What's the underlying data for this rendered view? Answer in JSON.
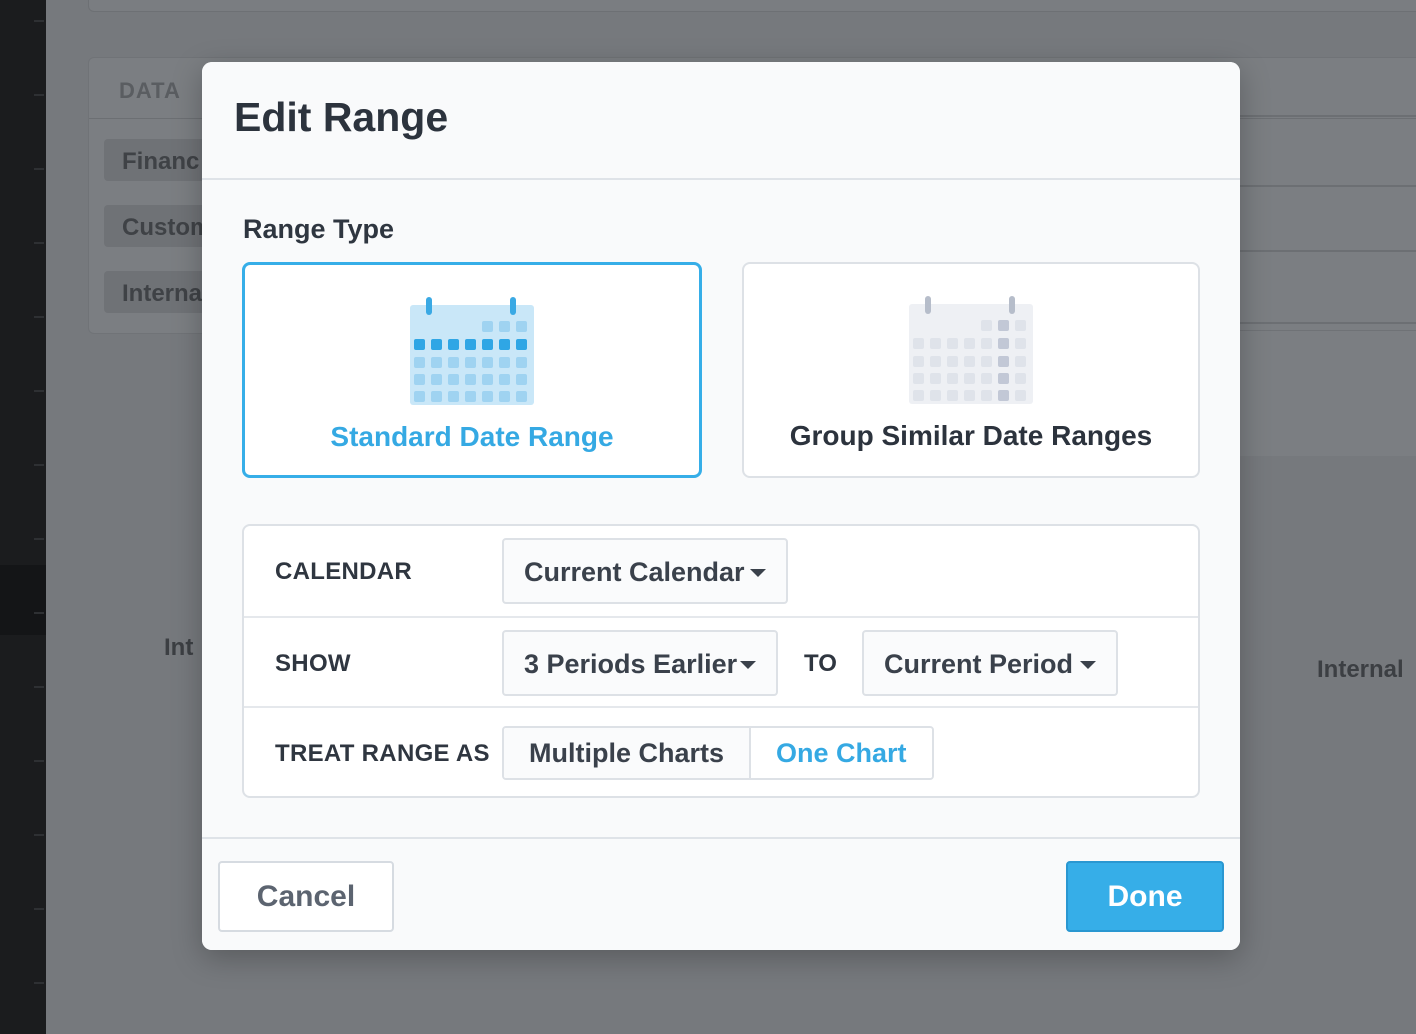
{
  "background": {
    "panel_header": "DATA",
    "chips": [
      "Financ",
      "Custom",
      "Interna"
    ],
    "labels": [
      "Int",
      "Internal"
    ]
  },
  "modal": {
    "title": "Edit Range",
    "range_type_label": "Range Type",
    "range_types": [
      {
        "label": "Standard Date Range",
        "selected": true,
        "icon": "calendar-icon"
      },
      {
        "label": "Group Similar Date Ranges",
        "selected": false,
        "icon": "calendar-icon"
      }
    ],
    "calendar": {
      "label": "CALENDAR",
      "value": "Current Calendar"
    },
    "show": {
      "label": "SHOW",
      "from": "3 Periods Earlier",
      "to_label": "TO",
      "to": "Current Period"
    },
    "treat_range_as": {
      "label": "TREAT RANGE AS",
      "options": [
        "Multiple Charts",
        "One Chart"
      ],
      "selected": "One Chart"
    },
    "buttons": {
      "cancel": "Cancel",
      "done": "Done"
    }
  },
  "colors": {
    "accent": "#36aee8",
    "text": "#2c333d"
  }
}
